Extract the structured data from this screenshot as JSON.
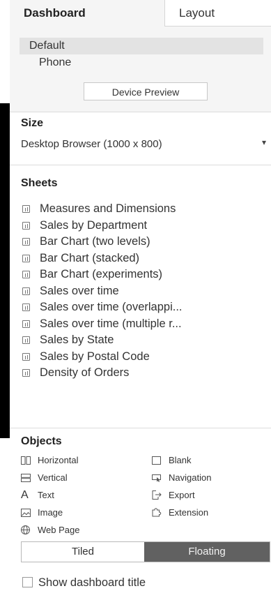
{
  "tabs": {
    "dashboard": "Dashboard",
    "layout": "Layout"
  },
  "devices": {
    "default": "Default",
    "phone": "Phone",
    "preview_button": "Device Preview"
  },
  "size": {
    "title": "Size",
    "value": "Desktop Browser (1000 x 800)"
  },
  "sheets": {
    "title": "Sheets",
    "items": [
      "Measures and Dimensions",
      "Sales by Department",
      "Bar Chart (two levels)",
      "Bar Chart (stacked)",
      "Bar Chart (experiments)",
      "Sales over time",
      "Sales over time (overlappi...",
      "Sales over time (multiple r...",
      "Sales by State",
      "Sales by Postal Code",
      "Density of Orders"
    ]
  },
  "objects": {
    "title": "Objects",
    "horizontal": "Horizontal",
    "vertical": "Vertical",
    "text": "Text",
    "image": "Image",
    "web_page": "Web Page",
    "blank": "Blank",
    "navigation": "Navigation",
    "export": "Export",
    "extension": "Extension"
  },
  "layout_mode": {
    "tiled": "Tiled",
    "floating": "Floating",
    "selected": "Floating"
  },
  "show_title": {
    "label": "Show dashboard title",
    "checked": false
  }
}
